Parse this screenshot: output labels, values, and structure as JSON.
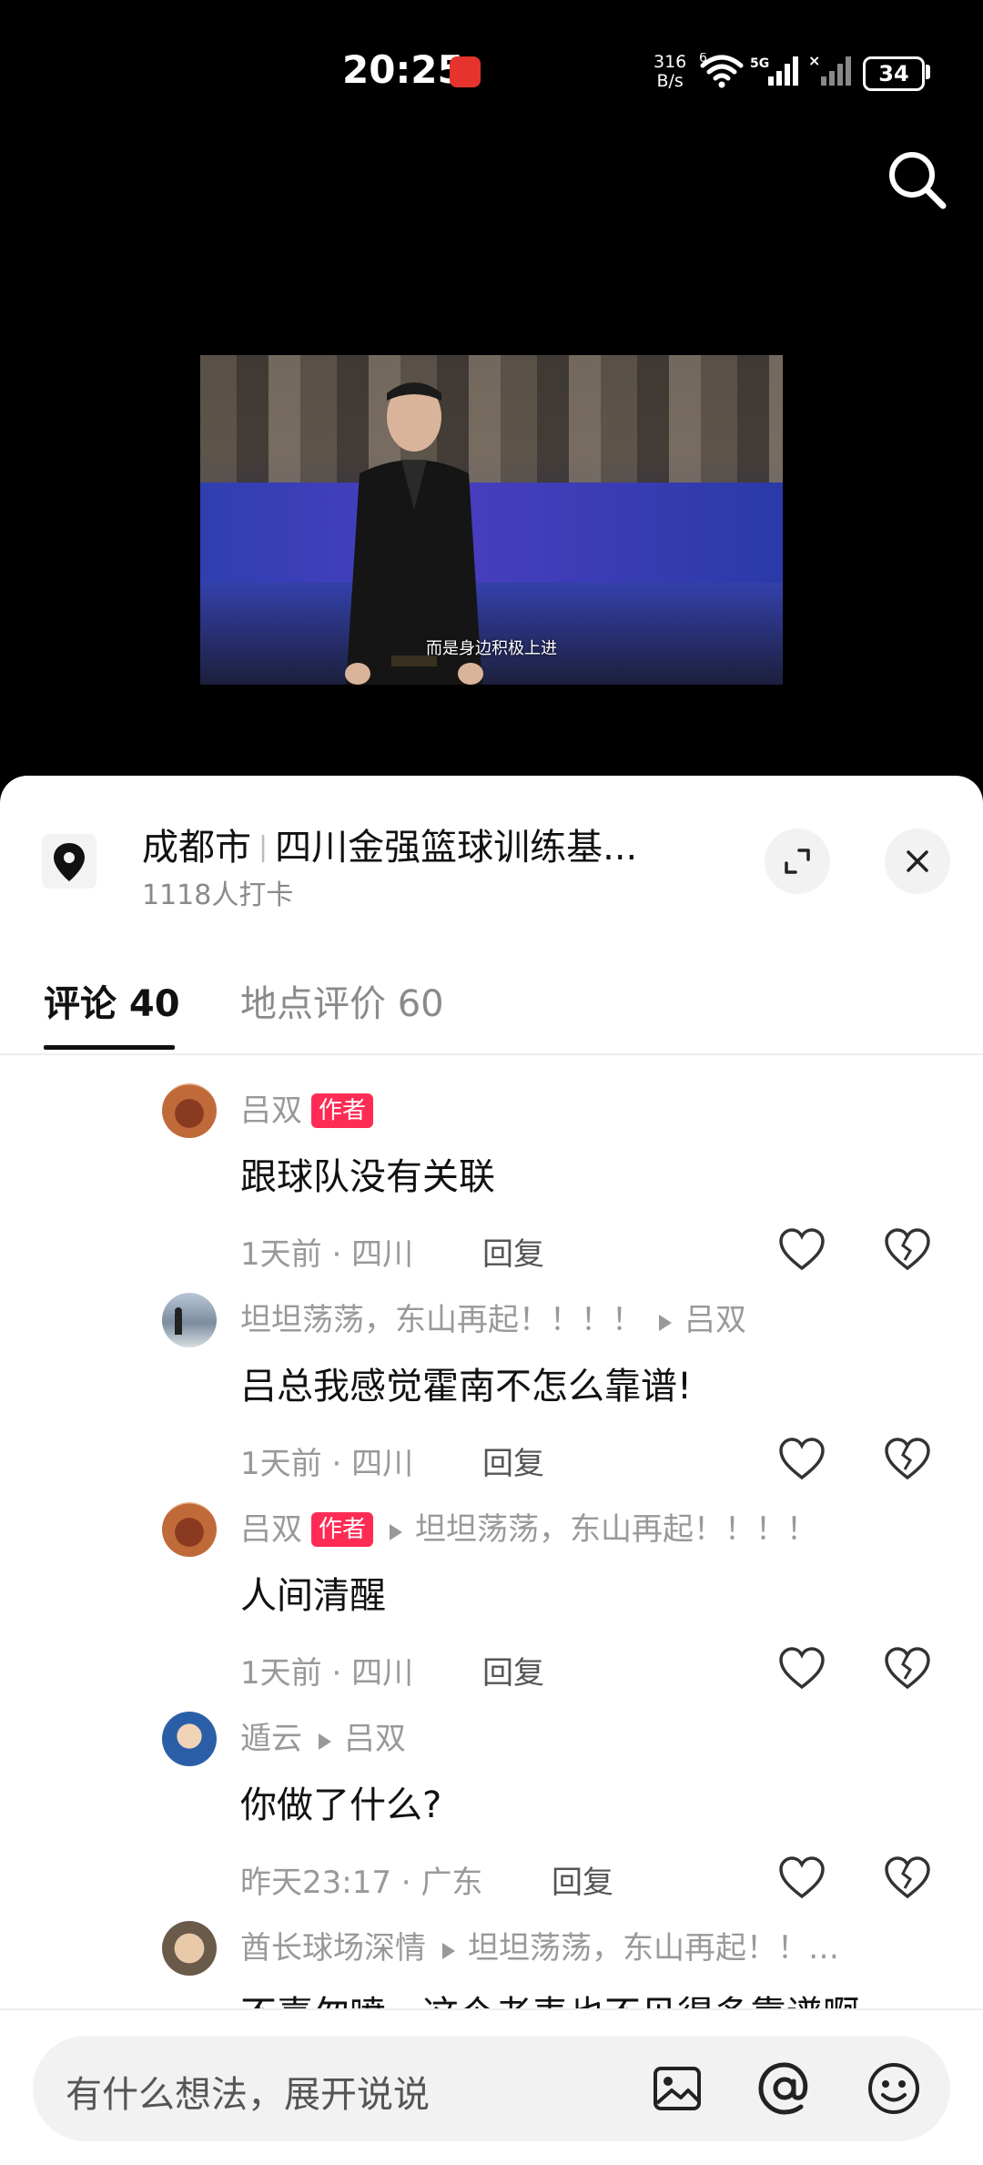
{
  "status_bar": {
    "time": "20:25",
    "net_speed_value": "316",
    "net_speed_unit": "B/s",
    "wifi_label": "6",
    "signal_label": "5G",
    "battery": "34"
  },
  "video": {
    "caption": "而是身边积极上进"
  },
  "location": {
    "city": "成都市",
    "place": "四川金强篮球训练基...",
    "checkins": "1118人打卡"
  },
  "tabs": {
    "comments": "评论 40",
    "place_reviews": "地点评价 60"
  },
  "comments": [
    {
      "author": "吕双",
      "is_author_tag": "作者",
      "reply_to": "",
      "text": "跟球队没有关联",
      "time": "1天前",
      "region": "四川",
      "reply_label": "回复"
    },
    {
      "author": "坦坦荡荡，东山再起！！！！",
      "is_author_tag": "",
      "reply_to": "吕双",
      "text": "吕总我感觉霍南不怎么靠谱!",
      "time": "1天前",
      "region": "四川",
      "reply_label": "回复"
    },
    {
      "author": "吕双",
      "is_author_tag": "作者",
      "reply_to": "坦坦荡荡，东山再起！！！！",
      "text": "人间清醒",
      "time": "1天前",
      "region": "四川",
      "reply_label": "回复"
    },
    {
      "author": "遁云",
      "is_author_tag": "",
      "reply_to": "吕双",
      "text": "你做了什么?",
      "time": "昨天23:17",
      "region": "广东",
      "reply_label": "回复"
    },
    {
      "author": "酋长球场深情",
      "is_author_tag": "",
      "reply_to": "坦坦荡荡，东山再起！！…",
      "text": "不喜勿喷，这个老表也不见得多靠谱啊",
      "time": "",
      "region": "",
      "reply_label": ""
    }
  ],
  "input": {
    "placeholder": "有什么想法，展开说说"
  },
  "colors": {
    "author_tag": "#fe2c55",
    "sheet_bg": "#ffffff",
    "screen_bg": "#000000"
  }
}
